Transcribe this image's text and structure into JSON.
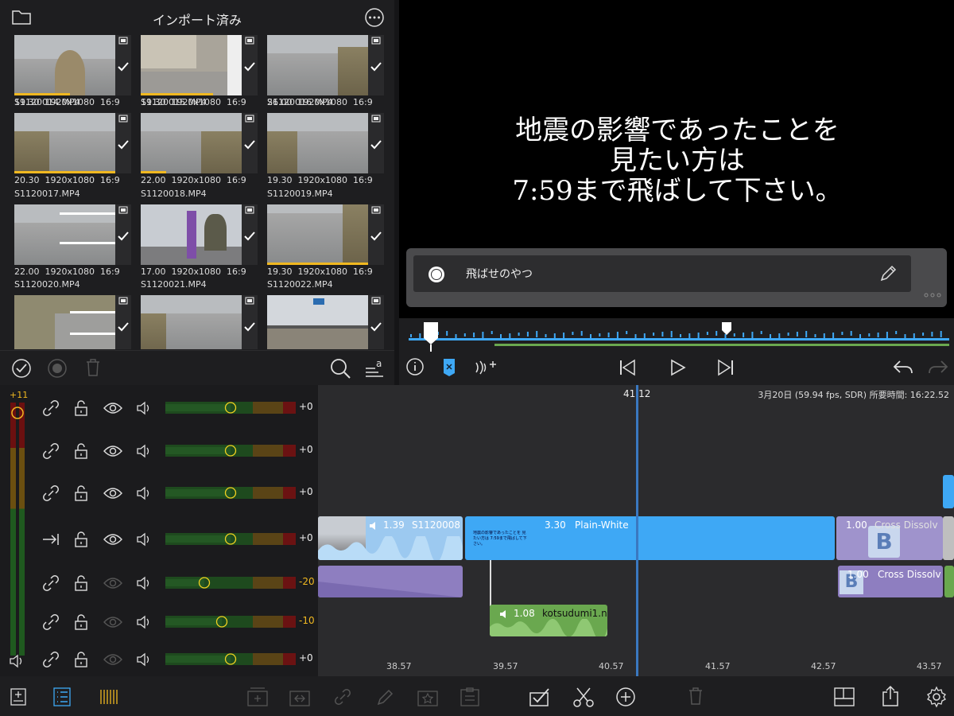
{
  "library": {
    "title": "インポート済み",
    "clips": [
      {
        "name": "",
        "duration": "19.30",
        "res": "1920x1080",
        "aspect": "16:9"
      },
      {
        "name": "",
        "duration": "19.30",
        "res": "1920x1080",
        "aspect": "16:9"
      },
      {
        "name": "",
        "duration": "26.00",
        "res": "1920x1080",
        "aspect": "16:9"
      },
      {
        "name": "S1120014.MP4",
        "duration": "20.30",
        "res": "1920x1080",
        "aspect": "16:9"
      },
      {
        "name": "S1120015.MP4",
        "duration": "22.00",
        "res": "1920x1080",
        "aspect": "16:9"
      },
      {
        "name": "S1120016.MP4",
        "duration": "19.30",
        "res": "1920x1080",
        "aspect": "16:9"
      },
      {
        "name": "S1120017.MP4",
        "duration": "22.00",
        "res": "1920x1080",
        "aspect": "16:9"
      },
      {
        "name": "S1120018.MP4",
        "duration": "17.00",
        "res": "1920x1080",
        "aspect": "16:9"
      },
      {
        "name": "S1120019.MP4",
        "duration": "19.30",
        "res": "1920x1080",
        "aspect": "16:9"
      },
      {
        "name": "S1120020.MP4",
        "duration": "",
        "res": "",
        "aspect": ""
      },
      {
        "name": "S1120021.MP4",
        "duration": "",
        "res": "",
        "aspect": ""
      },
      {
        "name": "S1120022.MP4",
        "duration": "",
        "res": "",
        "aspect": ""
      }
    ],
    "usage_fraction": [
      0.55,
      0.72,
      0.0,
      1.0,
      0.25,
      0.0,
      0.0,
      0.0,
      1.0,
      0,
      0,
      0
    ]
  },
  "viewer": {
    "subtitle_line1": "地震の影響であったことを",
    "subtitle_line2": "見たい方は",
    "subtitle_line3": "7:59まで飛ばして下さい。",
    "title_field": "飛ばせのやつ"
  },
  "tracks": [
    {
      "value": "+0",
      "level": 0.5
    },
    {
      "value": "+0",
      "level": 0.5
    },
    {
      "value": "+0",
      "level": 0.5
    },
    {
      "value": "+0",
      "level": 0.5
    },
    {
      "value": "-20",
      "level": 0.3
    },
    {
      "value": "-10",
      "level": 0.43
    },
    {
      "value": "+0",
      "level": 0.5
    }
  ],
  "meter": {
    "label": "+11"
  },
  "timeline": {
    "playhead": "41.12",
    "info": "3月20日 (59.94 fps, SDR) 所要時間: 16:22.52",
    "clips": {
      "a_duration": "1.39",
      "a_name": "S1120008",
      "b_duration": "3.30",
      "b_name": "Plain-White",
      "b_text": "地震の影響であったことを 見たい方は 7:59まで飛ばして下さい。",
      "c_duration": "1.00",
      "c_name": "Cross Dissolv",
      "d_duration": "1.00",
      "d_name": "Cross Dissolv",
      "e_duration": "1.08",
      "e_name": "kotsudumi1.n"
    },
    "ticks": [
      "38.57",
      "39.57",
      "40.57",
      "41.57",
      "42.57",
      "43.57"
    ]
  },
  "colors": {
    "accent": "#f0b820",
    "blue": "#3ea8f5",
    "purple": "#8e7ec0",
    "green": "#6aa84f"
  }
}
